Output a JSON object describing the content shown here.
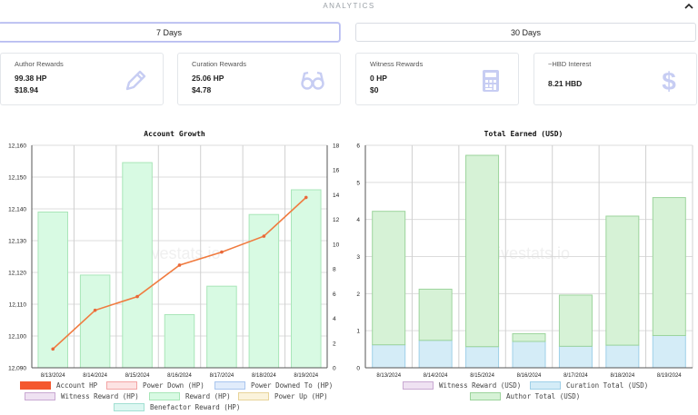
{
  "header": {
    "title": "ANALYTICS"
  },
  "range": {
    "seven_days": "7 Days",
    "thirty_days": "30 Days"
  },
  "cards": [
    {
      "title": "Author Rewards",
      "v1": "99.38 HP",
      "v2": "$18.94",
      "icon": "pencil-icon"
    },
    {
      "title": "Curation Rewards",
      "v1": "25.06 HP",
      "v2": "$4.78",
      "icon": "glasses-icon"
    },
    {
      "title": "Witness Rewards",
      "v1": "0 HP",
      "v2": "$0",
      "icon": "calculator-icon"
    },
    {
      "title": "~HBD Interest",
      "v1": "8.21 HBD",
      "v2": "",
      "icon": "dollar-icon"
    }
  ],
  "watermark": "hivestats.io",
  "colors": {
    "account_hp_line": "#f07b3f",
    "reward_fill": "#d8fae3",
    "reward_border": "#a8e6b8",
    "author_total_fill": "#d6f2d6",
    "author_total_border": "#9cd49c",
    "curation_total_fill": "#d4ecf7",
    "curation_total_border": "#9fd0e8"
  },
  "chart_data": [
    {
      "type": "bar",
      "title": "Account Growth",
      "categories": [
        "8/13/2024",
        "8/14/2024",
        "8/15/2024",
        "8/16/2024",
        "8/17/2024",
        "8/18/2024",
        "8/19/2024"
      ],
      "y_left_ticks": [
        "12,090",
        "12,100",
        "12,110",
        "12,120",
        "12,130",
        "12,140",
        "12,150",
        "12,160"
      ],
      "y_left_range": [
        12090,
        12160
      ],
      "y_right_ticks": [
        "0",
        "2",
        "4",
        "6",
        "8",
        "10",
        "12",
        "14",
        "16",
        "18"
      ],
      "y_right_range": [
        0,
        18
      ],
      "series": [
        {
          "name": "Account HP",
          "kind": "line",
          "axis": "left",
          "values": [
            12095.9,
            12108.1,
            12112.4,
            12122.3,
            12126.4,
            12131.4,
            12143.6
          ]
        },
        {
          "name": "Reward (HP)",
          "kind": "bar",
          "axis": "right",
          "values": [
            12.6,
            7.5,
            16.6,
            4.3,
            6.6,
            12.4,
            14.4
          ]
        }
      ],
      "legend": [
        {
          "label": "Account HP",
          "fill": "#f4582e",
          "border": "#f4582e"
        },
        {
          "label": "Power Down (HP)",
          "fill": "#fde3e3",
          "border": "#f3a5a5"
        },
        {
          "label": "Power Downed To (HP)",
          "fill": "#e1ecfb",
          "border": "#a9c5ee"
        },
        {
          "label": "Witness Reward (HP)",
          "fill": "#efe2f2",
          "border": "#c9a9d2"
        },
        {
          "label": "Reward (HP)",
          "fill": "#d8fae3",
          "border": "#a8e6b8"
        },
        {
          "label": "Power Up (HP)",
          "fill": "#fbf3dc",
          "border": "#e8d49a"
        },
        {
          "label": "Benefactor Reward (HP)",
          "fill": "#dcf7f1",
          "border": "#a2e0d2"
        }
      ]
    },
    {
      "type": "bar",
      "title": "Total Earned (USD)",
      "stacked": true,
      "categories": [
        "8/13/2024",
        "8/14/2024",
        "8/15/2024",
        "8/16/2024",
        "8/17/2024",
        "8/18/2024",
        "8/19/2024"
      ],
      "y_ticks": [
        "0",
        "1",
        "2",
        "3",
        "4",
        "5",
        "6"
      ],
      "y_range": [
        0,
        6
      ],
      "series": [
        {
          "name": "Witness Reward (USD)",
          "values": [
            0,
            0,
            0,
            0,
            0,
            0,
            0
          ]
        },
        {
          "name": "Curation Total (USD)",
          "values": [
            0.62,
            0.74,
            0.57,
            0.71,
            0.58,
            0.61,
            0.87
          ]
        },
        {
          "name": "Author Total (USD)",
          "values": [
            3.6,
            1.38,
            5.16,
            0.21,
            1.38,
            3.48,
            3.72
          ]
        }
      ],
      "legend": [
        {
          "label": "Witness Reward (USD)",
          "fill": "#efe2f2",
          "border": "#c9a9d2"
        },
        {
          "label": "Curation Total (USD)",
          "fill": "#d4ecf7",
          "border": "#9fd0e8"
        },
        {
          "label": "Author Total (USD)",
          "fill": "#d6f2d6",
          "border": "#9cd49c"
        }
      ]
    }
  ]
}
